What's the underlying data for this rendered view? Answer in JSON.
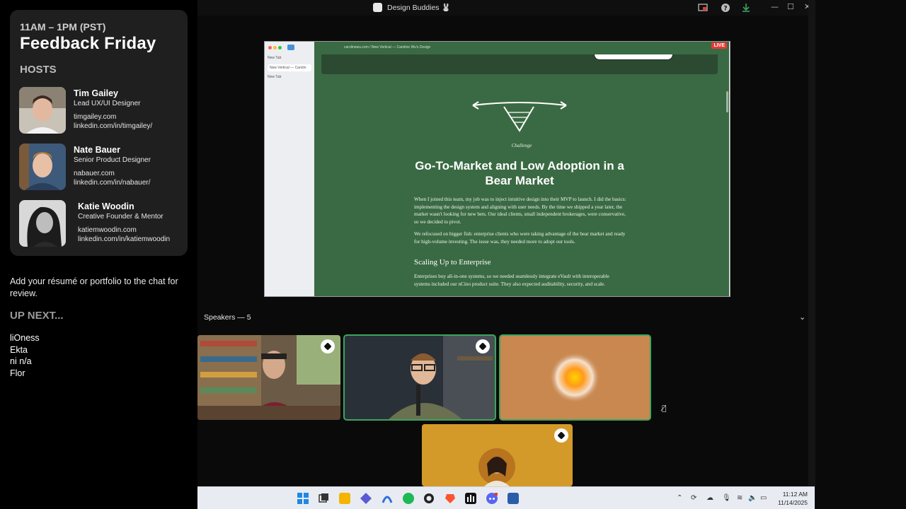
{
  "overlay": {
    "time": "11AM – 1PM (PST)",
    "title": "Feedback Friday",
    "hosts_heading": "HOSTS",
    "hosts": [
      {
        "name": "Tim Gailey",
        "role": "Lead UX/UI Designer",
        "site": "timgailey.com",
        "linkedin": "linkedin.com/in/timgailey/"
      },
      {
        "name": "Nate Bauer",
        "role": "Senior Product Designer",
        "site": "nabauer.com",
        "linkedin": "linkedin.com/in/nabauer/"
      },
      {
        "name": "Katie Woodin",
        "role": "Creative Founder & Mentor",
        "site": "katiemwoodin.com",
        "linkedin": "linkedin.com/in/katiemwoodin"
      }
    ],
    "note": "Add your résumé or portfolio to the chat for review.",
    "up_next_heading": "UP NEXT...",
    "queue": [
      "liOness",
      "Ekta",
      "ni n/a",
      "Flor"
    ]
  },
  "window": {
    "title": "Design Buddies 🐰",
    "controls": {
      "minimize": "—",
      "maximize": "☐",
      "close": "✕"
    }
  },
  "shared_screen": {
    "live_badge": "LIVE",
    "url": "carolinewu.com / New Vertical — Caroline Wu's Design",
    "tabs": [
      "New Tab",
      "New Vertical — Carolin",
      "New Tab"
    ],
    "challenge_label": "Challenge",
    "headline": "Go-To-Market and Low Adoption in a Bear Market",
    "paragraph1": "When I joined this team, my job was to inject intuitive design into their MVP to launch. I did the basics: implementing the design system and aligning with user needs. By the time we shipped a year later, the market wasn't looking for new bets. Our ideal clients, small independent brokerages, were conservative, so we decided to pivot.",
    "paragraph2": "We refocused on bigger fish: enterprise clients who were taking advantage of the bear market and ready for high-volume investing. The issue was, they needed more to adopt our tools.",
    "subheading": "Scaling Up to Enterprise",
    "paragraph3": "Enterprises buy all-in-one systems, so we needed seamlessly integrate eVault with interoperable systems included our nCino product suite. They also expected auditability, security, and scale."
  },
  "speakers": {
    "label": "Speakers — 5"
  },
  "taskbar": {
    "time": "11:12 AM",
    "date": "11/14/2025"
  },
  "colors": {
    "overlay_card": "#1f1f20",
    "browser_green": "#3a6a43",
    "speaking_outline": "#3ba55d",
    "tile_orange": "#c8884f",
    "tile_gold": "#d39a2a",
    "live_red": "#e53935"
  }
}
